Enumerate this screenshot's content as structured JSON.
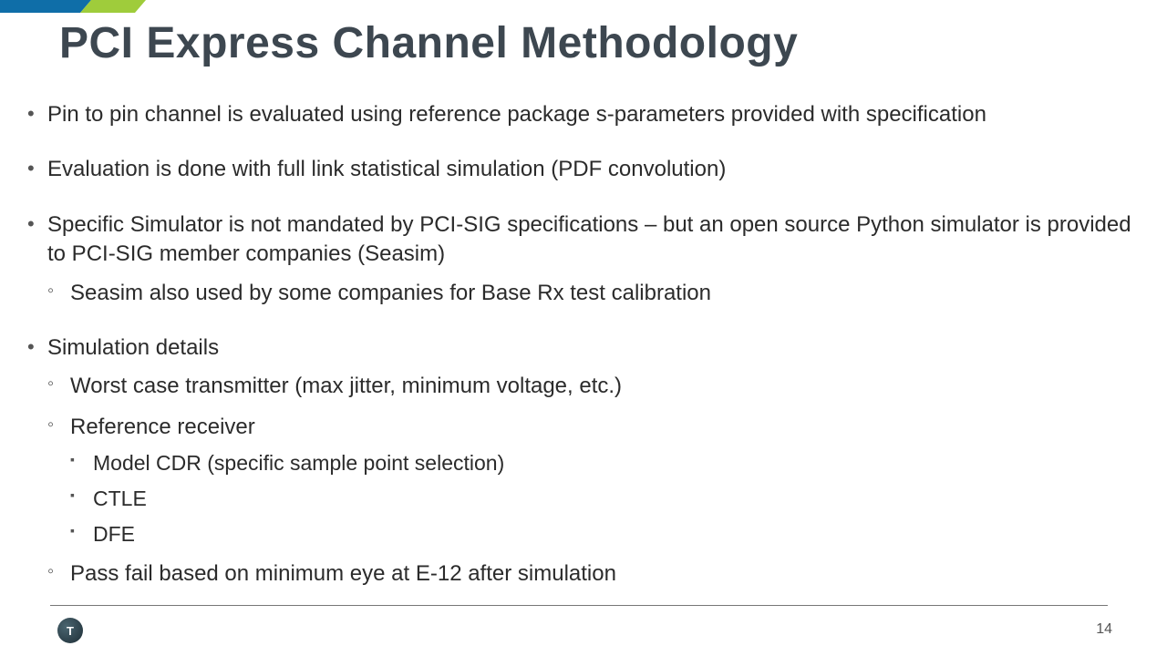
{
  "title": "PCI Express Channel Methodology",
  "bullets": [
    {
      "text": "Pin to pin channel is evaluated using reference package s-parameters provided with specification"
    },
    {
      "text": "Evaluation is done with full link statistical simulation (PDF convolution)"
    },
    {
      "text": "Specific Simulator is not mandated by PCI-SIG specifications – but an open source Python simulator is provided to PCI-SIG member companies (Seasim)",
      "children": [
        {
          "text": "Seasim also used by some companies for Base Rx test calibration"
        }
      ]
    },
    {
      "text": "Simulation details",
      "children": [
        {
          "text": "Worst case transmitter (max jitter, minimum voltage, etc.)"
        },
        {
          "text": "Reference receiver",
          "children": [
            {
              "text": "Model CDR (specific sample point selection)"
            },
            {
              "text": "CTLE"
            },
            {
              "text": "DFE"
            }
          ]
        },
        {
          "text": "Pass fail based on minimum eye at E-12 after simulation"
        }
      ]
    }
  ],
  "page_number": "14",
  "logo_text": "T"
}
